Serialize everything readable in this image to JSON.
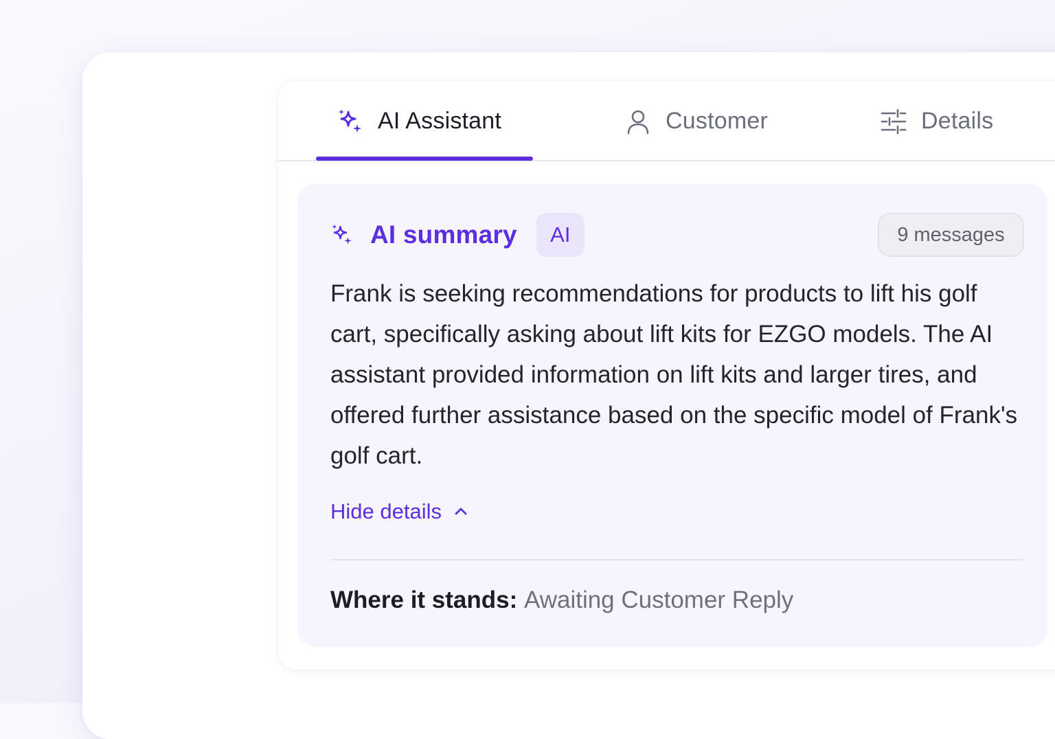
{
  "tabs": [
    {
      "label": "AI Assistant",
      "icon": "sparkle-icon",
      "active": true
    },
    {
      "label": "Customer",
      "icon": "user-icon",
      "active": false
    },
    {
      "label": "Details",
      "icon": "sliders-icon",
      "active": false
    }
  ],
  "summary": {
    "title": "AI summary",
    "badge": "AI",
    "message_count": "9 messages",
    "body": "Frank is seeking recommendations for products to lift his golf cart, specifically asking about lift kits for EZGO models. The AI assistant provided information on lift kits and larger tires, and offered further assistance based on the specific model of Frank's golf cart.",
    "toggle_label": "Hide details",
    "status_label": "Where it stands:",
    "status_value": "Awaiting Customer Reply"
  },
  "colors": {
    "accent": "#5b2ee0",
    "badge_bg": "#ebe5fc",
    "card_bg": "#f6f4fc",
    "text": "#23242d",
    "muted": "#6e717c"
  }
}
